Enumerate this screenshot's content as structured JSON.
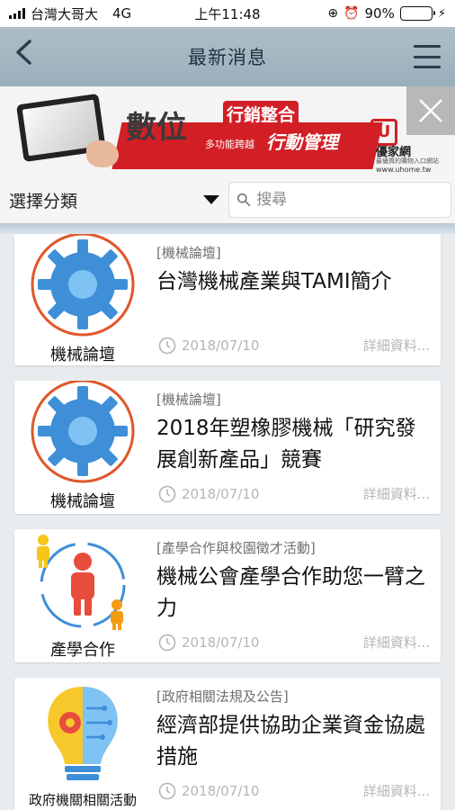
{
  "status": {
    "carrier": "台灣大哥大",
    "network": "4G",
    "time": "上午11:48",
    "battery": "90%",
    "battery_level": 0.9
  },
  "nav": {
    "title": "最新消息"
  },
  "banner": {
    "main_text_1": "數位",
    "tag_1": "行銷整合",
    "sub_text": "多功能跨越",
    "tag_2": "行動管理",
    "brand_mark": "U",
    "brand_name": "優家網",
    "brand_slogan": "最優質的購物入口網站",
    "brand_url": "www.uhome.tw"
  },
  "filter": {
    "category_label": "選擇分類",
    "search_placeholder": "搜尋"
  },
  "items": [
    {
      "category": "[機械論壇]",
      "title": "台灣機械產業與TAMI簡介",
      "thumb_label": "機械論壇",
      "date": "2018/07/10",
      "more": "詳細資料..."
    },
    {
      "category": "[機械論壇]",
      "title": "2018年塑橡膠機械「研究發展創新產品」競賽",
      "thumb_label": "機械論壇",
      "date": "2018/07/10",
      "more": "詳細資料..."
    },
    {
      "category": "[產學合作與校園徵才活動]",
      "title": "機械公會產學合作助您一臂之力",
      "thumb_label": "產學合作",
      "date": "2018/07/10",
      "more": "詳細資料..."
    },
    {
      "category": "[政府相關法規及公告]",
      "title": "經濟部提供協助企業資金協處措施",
      "thumb_label": "政府機關相關活動",
      "date": "2018/07/10",
      "more": "詳細資料..."
    }
  ]
}
